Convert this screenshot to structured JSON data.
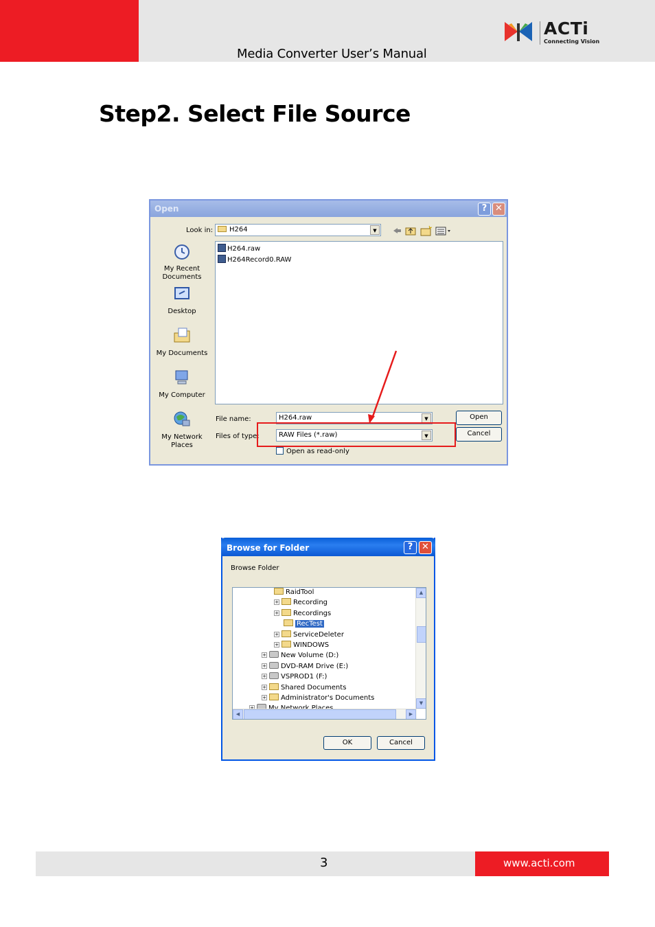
{
  "header": {
    "manual_title": "Media Converter User’s Manual",
    "logo_text": "ACTi",
    "logo_tagline": "Connecting Vision"
  },
  "section": {
    "title": "Step2. Select File Source"
  },
  "open_dialog": {
    "title": "Open",
    "help_glyph": "?",
    "close_glyph": "✕",
    "look_in_label": "Look in:",
    "look_in_value": "H264",
    "places": [
      {
        "label": "My Recent Documents"
      },
      {
        "label": "Desktop"
      },
      {
        "label": "My Documents"
      },
      {
        "label": "My Computer"
      },
      {
        "label": "My Network Places"
      }
    ],
    "files": [
      "H264.raw",
      "H264Record0.RAW"
    ],
    "file_name_label": "File name:",
    "file_name_value": "H264.raw",
    "file_type_label": "Files of type:",
    "file_type_value": "RAW Files (*.raw)",
    "read_only_label": "Open as read-only",
    "open_button": "Open",
    "cancel_button": "Cancel",
    "highlight_color": "#e61b1b"
  },
  "browse_dialog": {
    "title": "Browse for Folder",
    "help_glyph": "?",
    "close_glyph": "✕",
    "instruction": "Browse Folder",
    "tree": [
      {
        "label": "RaidTool",
        "expander": ""
      },
      {
        "label": "Recording",
        "expander": "+"
      },
      {
        "label": "Recordings",
        "expander": "+"
      },
      {
        "label": "RecTest",
        "expander": "",
        "selected": true
      },
      {
        "label": "ServiceDeleter",
        "expander": "+"
      },
      {
        "label": "WINDOWS",
        "expander": "+"
      },
      {
        "label": "New Volume (D:)",
        "expander": "+"
      },
      {
        "label": "DVD-RAM Drive (E:)",
        "expander": "+"
      },
      {
        "label": "VSPROD1 (F:)",
        "expander": "+"
      },
      {
        "label": "Shared Documents",
        "expander": "+"
      },
      {
        "label": "Administrator's Documents",
        "expander": "+"
      },
      {
        "label": "My Network Places",
        "expander": "+"
      }
    ],
    "ok_button": "OK",
    "cancel_button": "Cancel"
  },
  "footer": {
    "page_number": "3",
    "website": "www.acti.com"
  }
}
